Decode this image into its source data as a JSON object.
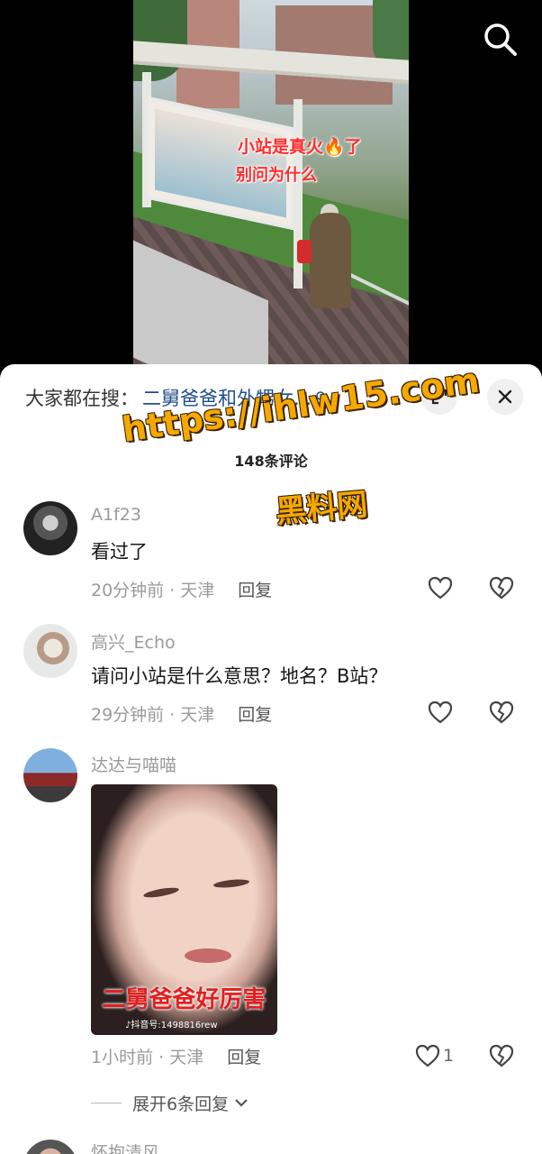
{
  "video": {
    "caption_line1": "小站是真火🔥了",
    "caption_line2": "别问为什么"
  },
  "top_bar": {
    "search_icon": "search-icon"
  },
  "sheet": {
    "search_prefix": "大家都在搜：",
    "search_query": "二舅爸爸和外甥女...",
    "search_query_icon": "search-icon",
    "expand_icon": "expand-icon",
    "close_icon": "close-icon",
    "count_text": "148条评论"
  },
  "comments": [
    {
      "username": "A1f23",
      "text": "看过了",
      "time_location": "20分钟前 · 天津",
      "reply_label": "回复",
      "likes": ""
    },
    {
      "username": "高兴_Echo",
      "text": "请问小站是什么意思？地名？B站？",
      "time_location": "29分钟前 · 天津",
      "reply_label": "回复",
      "likes": ""
    },
    {
      "username": "达达与喵喵",
      "image_caption": "二舅爸爸好厉害",
      "image_watermark": "♪抖音号:1498816rew",
      "time_location": "1小时前 · 天津",
      "reply_label": "回复",
      "likes": "1",
      "expand_replies": "展开6条回复"
    },
    {
      "username": "怀抱清风"
    }
  ],
  "watermark": {
    "url": "https://ihlw15.com",
    "name": "黑料网"
  },
  "colors": {
    "link_blue": "#1f4d8a",
    "watermark_orange": "#f5a800",
    "caption_red": "#ff2d2d"
  }
}
